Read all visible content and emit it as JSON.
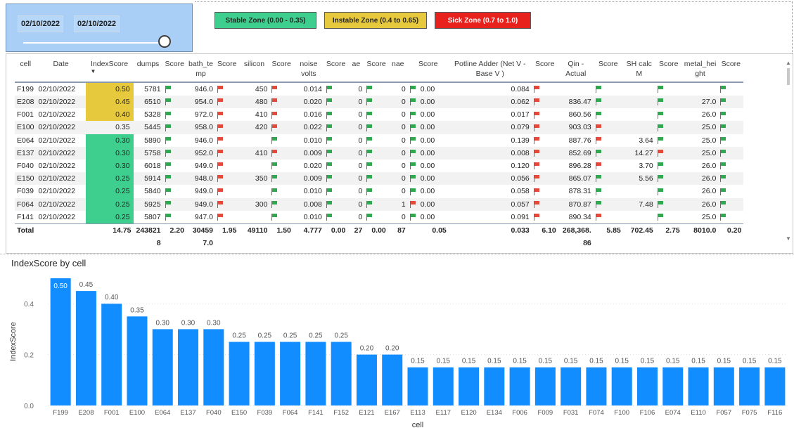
{
  "slicer": {
    "start_date": "02/10/2022",
    "end_date": "02/10/2022",
    "slider_position": 1.0
  },
  "zones": [
    {
      "label": "Stable Zone (0.00 - 0.35)",
      "color": "#3ecf8e"
    },
    {
      "label": "Instable Zone (0.4 to 0.65)",
      "color": "#e6c93c"
    },
    {
      "label": "Sick Zone (0.7 to 1.0)",
      "color": "#e8211d"
    }
  ],
  "table": {
    "columns": [
      "cell",
      "Date",
      "IndexScore",
      "dumps",
      "Score",
      "bath_te mp",
      "Score",
      "silicon",
      "Score",
      "noise volts",
      "Score",
      "ae",
      "Score",
      "nae",
      "Score",
      "Potline Adder (Net V - Base V )",
      "Score",
      "Qin - Actual",
      "Score",
      "SH calc M",
      "Score",
      "metal_hei ght",
      "Score"
    ],
    "sorted_column": "IndexScore",
    "rows": [
      {
        "cell": "F199",
        "date": "02/10/2022",
        "index": "0.50",
        "index_zone": "instable",
        "dumps": "5781",
        "s1": "green",
        "bath": "946.0",
        "s2": "red",
        "silicon": "450",
        "s3": "red",
        "noise": "0.014",
        "s4": "green",
        "ae": "0",
        "s5": "green",
        "nae": "0",
        "s6_flag": "green",
        "s6": "0.00",
        "adder": "0.084",
        "s7": "red",
        "qin": "",
        "s8": "green",
        "sh": "",
        "s9": "green",
        "metal": "",
        "s10": "green"
      },
      {
        "cell": "E208",
        "date": "02/10/2022",
        "index": "0.45",
        "index_zone": "instable",
        "dumps": "6510",
        "s1": "green",
        "bath": "954.0",
        "s2": "red",
        "silicon": "480",
        "s3": "red",
        "noise": "0.020",
        "s4": "green",
        "ae": "0",
        "s5": "green",
        "nae": "0",
        "s6_flag": "green",
        "s6": "0.00",
        "adder": "0.062",
        "s7": "red",
        "qin": "836.47",
        "s8": "green",
        "sh": "",
        "s9": "green",
        "metal": "27.0",
        "s10": "green"
      },
      {
        "cell": "F001",
        "date": "02/10/2022",
        "index": "0.40",
        "index_zone": "instable",
        "dumps": "5328",
        "s1": "green",
        "bath": "972.0",
        "s2": "red",
        "silicon": "410",
        "s3": "red",
        "noise": "0.016",
        "s4": "green",
        "ae": "0",
        "s5": "green",
        "nae": "0",
        "s6_flag": "green",
        "s6": "0.00",
        "adder": "0.017",
        "s7": "red",
        "qin": "860.56",
        "s8": "green",
        "sh": "",
        "s9": "green",
        "metal": "26.0",
        "s10": "green"
      },
      {
        "cell": "E100",
        "date": "02/10/2022",
        "index": "0.35",
        "index_zone": "none",
        "dumps": "5445",
        "s1": "green",
        "bath": "958.0",
        "s2": "red",
        "silicon": "420",
        "s3": "red",
        "noise": "0.022",
        "s4": "green",
        "ae": "0",
        "s5": "green",
        "nae": "0",
        "s6_flag": "green",
        "s6": "0.00",
        "adder": "0.079",
        "s7": "red",
        "qin": "903.03",
        "s8": "red",
        "sh": "",
        "s9": "green",
        "metal": "25.0",
        "s10": "green"
      },
      {
        "cell": "E064",
        "date": "02/10/2022",
        "index": "0.30",
        "index_zone": "stable",
        "dumps": "5890",
        "s1": "green",
        "bath": "946.0",
        "s2": "red",
        "silicon": "",
        "s3": "green",
        "noise": "0.010",
        "s4": "green",
        "ae": "0",
        "s5": "green",
        "nae": "0",
        "s6_flag": "green",
        "s6": "0.00",
        "adder": "0.139",
        "s7": "red",
        "qin": "887.76",
        "s8": "red",
        "sh": "3.64",
        "s9": "green",
        "metal": "25.0",
        "s10": "green"
      },
      {
        "cell": "E137",
        "date": "02/10/2022",
        "index": "0.30",
        "index_zone": "stable",
        "dumps": "5758",
        "s1": "green",
        "bath": "952.0",
        "s2": "red",
        "silicon": "410",
        "s3": "red",
        "noise": "0.009",
        "s4": "green",
        "ae": "0",
        "s5": "green",
        "nae": "0",
        "s6_flag": "green",
        "s6": "0.00",
        "adder": "0.008",
        "s7": "red",
        "qin": "852.69",
        "s8": "green",
        "sh": "14.27",
        "s9": "red",
        "metal": "25.0",
        "s10": "green"
      },
      {
        "cell": "F040",
        "date": "02/10/2022",
        "index": "0.30",
        "index_zone": "stable",
        "dumps": "6018",
        "s1": "green",
        "bath": "949.0",
        "s2": "red",
        "silicon": "",
        "s3": "green",
        "noise": "0.020",
        "s4": "green",
        "ae": "0",
        "s5": "green",
        "nae": "0",
        "s6_flag": "green",
        "s6": "0.00",
        "adder": "0.120",
        "s7": "red",
        "qin": "896.28",
        "s8": "red",
        "sh": "3.70",
        "s9": "green",
        "metal": "26.0",
        "s10": "green"
      },
      {
        "cell": "E150",
        "date": "02/10/2022",
        "index": "0.25",
        "index_zone": "stable",
        "dumps": "5914",
        "s1": "green",
        "bath": "948.0",
        "s2": "red",
        "silicon": "350",
        "s3": "green",
        "noise": "0.009",
        "s4": "green",
        "ae": "0",
        "s5": "green",
        "nae": "0",
        "s6_flag": "green",
        "s6": "0.00",
        "adder": "0.056",
        "s7": "red",
        "qin": "865.07",
        "s8": "green",
        "sh": "5.56",
        "s9": "green",
        "metal": "26.0",
        "s10": "green"
      },
      {
        "cell": "F039",
        "date": "02/10/2022",
        "index": "0.25",
        "index_zone": "stable",
        "dumps": "5840",
        "s1": "green",
        "bath": "949.0",
        "s2": "red",
        "silicon": "",
        "s3": "green",
        "noise": "0.010",
        "s4": "green",
        "ae": "0",
        "s5": "green",
        "nae": "0",
        "s6_flag": "green",
        "s6": "0.00",
        "adder": "0.058",
        "s7": "red",
        "qin": "878.31",
        "s8": "green",
        "sh": "",
        "s9": "green",
        "metal": "26.0",
        "s10": "green"
      },
      {
        "cell": "F064",
        "date": "02/10/2022",
        "index": "0.25",
        "index_zone": "stable",
        "dumps": "5925",
        "s1": "green",
        "bath": "949.0",
        "s2": "red",
        "silicon": "300",
        "s3": "green",
        "noise": "0.008",
        "s4": "green",
        "ae": "0",
        "s5": "green",
        "nae": "1",
        "s6_flag": "red",
        "s6": "0.00",
        "adder": "0.057",
        "s7": "red",
        "qin": "870.87",
        "s8": "green",
        "sh": "7.48",
        "s9": "green",
        "metal": "26.0",
        "s10": "green"
      },
      {
        "cell": "F141",
        "date": "02/10/2022",
        "index": "0.25",
        "index_zone": "stable",
        "dumps": "5807",
        "s1": "green",
        "bath": "947.0",
        "s2": "red",
        "silicon": "",
        "s3": "green",
        "noise": "0.010",
        "s4": "green",
        "ae": "0",
        "s5": "green",
        "nae": "0",
        "s6_flag": "green",
        "s6": "0.00",
        "adder": "0.091",
        "s7": "red",
        "qin": "890.34",
        "s8": "red",
        "sh": "",
        "s9": "green",
        "metal": "25.0",
        "s10": "green"
      }
    ],
    "total": {
      "label": "Total",
      "index": "14.75",
      "dumps": "243821 8",
      "s1": "2.20",
      "bath": "30459 7.0",
      "s2": "1.95",
      "silicon": "49110",
      "s3": "1.50",
      "noise": "4.777",
      "s4": "0.00",
      "ae": "27",
      "s5": "0.00",
      "nae": "87",
      "s6": "0.05",
      "adder": "0.033",
      "s7": "6.10",
      "qin": "268,368. 86",
      "s8": "5.85",
      "sh": "702.45",
      "s9": "2.75",
      "metal": "8010.0",
      "s10": "0.20"
    }
  },
  "chart_data": {
    "type": "bar",
    "title": "IndexScore by cell",
    "xlabel": "cell",
    "ylabel": "IndexScore",
    "ylim": [
      0,
      0.5
    ],
    "yticks": [
      "0.0",
      "0.2",
      "0.4"
    ],
    "ytick_values": [
      0,
      0.2,
      0.4
    ],
    "grid": true,
    "bar_color": "#118dff",
    "categories": [
      "F199",
      "E208",
      "F001",
      "E100",
      "E064",
      "E137",
      "F040",
      "E150",
      "F039",
      "F064",
      "F141",
      "F152",
      "E121",
      "E167",
      "E113",
      "E117",
      "E120",
      "E134",
      "F006",
      "F009",
      "F031",
      "F074",
      "F100",
      "F106",
      "E074",
      "E110",
      "F057",
      "F075",
      "F116"
    ],
    "values": [
      0.5,
      0.45,
      0.4,
      0.35,
      0.3,
      0.3,
      0.3,
      0.25,
      0.25,
      0.25,
      0.25,
      0.25,
      0.2,
      0.2,
      0.15,
      0.15,
      0.15,
      0.15,
      0.15,
      0.15,
      0.15,
      0.15,
      0.15,
      0.15,
      0.15,
      0.15,
      0.15,
      0.15,
      0.15
    ],
    "labels": [
      "0.50",
      "0.45",
      "0.40",
      "0.35",
      "0.30",
      "0.30",
      "0.30",
      "0.25",
      "0.25",
      "0.25",
      "0.25",
      "0.25",
      "0.20",
      "0.20",
      "0.15",
      "0.15",
      "0.15",
      "0.15",
      "0.15",
      "0.15",
      "0.15",
      "0.15",
      "0.15",
      "0.15",
      "0.15",
      "0.15",
      "0.15",
      "0.15",
      "0.15"
    ]
  }
}
